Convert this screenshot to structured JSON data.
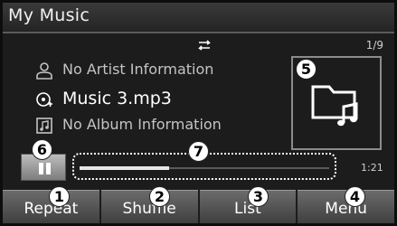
{
  "header": {
    "title": "My Music"
  },
  "status": {
    "repeat_icon": "repeat-icon",
    "track_counter": "1/9"
  },
  "track": {
    "artist": "No Artist Information",
    "file": "Music 3.mp3",
    "album": "No Album Information",
    "artist_icon": "person-icon",
    "file_icon": "music-file-icon",
    "album_icon": "album-icon"
  },
  "album_art_icon": "music-folder-icon",
  "player": {
    "state": "playing",
    "pause_icon": "pause-icon",
    "progress": 0.36,
    "elapsed": "1:21"
  },
  "callouts": [
    "1",
    "2",
    "3",
    "4",
    "5",
    "6",
    "7"
  ],
  "buttons": {
    "repeat": "Repeat",
    "shuffle": "Shuffle",
    "list": "List",
    "menu": "Menu"
  },
  "colors": {
    "background": "#1c1c1c",
    "text": "#ffffff",
    "button": "#555555"
  }
}
